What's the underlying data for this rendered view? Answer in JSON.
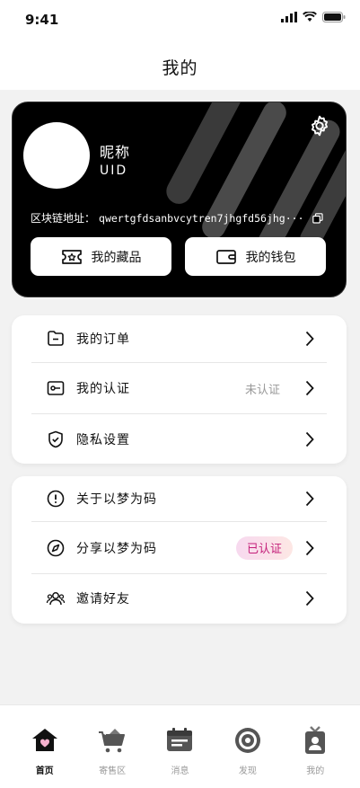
{
  "status_bar": {
    "time": "9:41"
  },
  "header": {
    "title": "我的"
  },
  "profile": {
    "nickname": "昵称",
    "uid": "UID",
    "chain_label": "区块链地址：",
    "chain_address": "qwertgfdsanbvcytren7jhgfd56jhg···",
    "collection_button": "我的藏品",
    "wallet_button": "我的钱包"
  },
  "menu_group_1": [
    {
      "label": "我的订单",
      "icon": "folder-icon"
    },
    {
      "label": "我的认证",
      "icon": "id-card-icon",
      "status": "未认证"
    },
    {
      "label": "隐私设置",
      "icon": "shield-icon"
    }
  ],
  "menu_group_2": [
    {
      "label": "关于以梦为码",
      "icon": "info-icon"
    },
    {
      "label": "分享以梦为码",
      "icon": "compass-icon",
      "badge": "已认证"
    },
    {
      "label": "邀请好友",
      "icon": "users-icon"
    }
  ],
  "tabs": [
    {
      "label": "首页",
      "icon": "home-icon",
      "active": true
    },
    {
      "label": "寄售区",
      "icon": "cart-icon"
    },
    {
      "label": "消息",
      "icon": "message-icon"
    },
    {
      "label": "发现",
      "icon": "target-icon"
    },
    {
      "label": "我的",
      "icon": "profile-badge-icon"
    }
  ],
  "colors": {
    "card_bg": "#000000",
    "badge_text": "#c41f7a",
    "page_bg": "#f2f2f2"
  }
}
